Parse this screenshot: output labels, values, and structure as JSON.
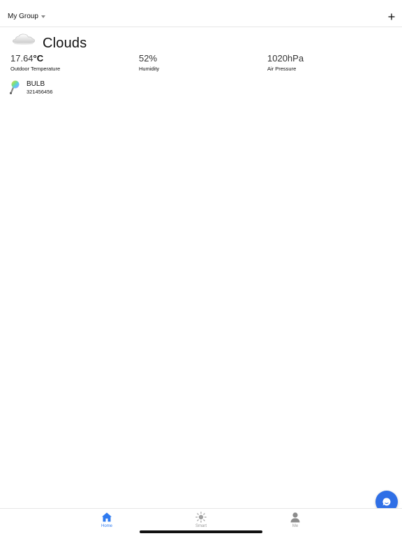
{
  "header": {
    "group_name": "My Group",
    "add_icon": "plus-icon"
  },
  "weather": {
    "icon": "cloud-icon",
    "condition": "Clouds",
    "temperature": {
      "value": "17.64",
      "unit": "°C",
      "label": "Outdoor Temperature"
    },
    "humidity": {
      "value": "52%",
      "label": "Humidity"
    },
    "pressure": {
      "value": "1020hPa",
      "label": "Air Pressure"
    }
  },
  "devices": [
    {
      "icon": "bulb-icon",
      "name": "BULB",
      "id": "321456456"
    }
  ],
  "fab": {
    "icon": "chat-icon",
    "color": "#2f6fe6"
  },
  "tabs": [
    {
      "label": "Home",
      "icon": "home-icon",
      "active": true
    },
    {
      "label": "Smart",
      "icon": "sun-icon",
      "active": false
    },
    {
      "label": "Me",
      "icon": "person-icon",
      "active": false
    }
  ],
  "colors": {
    "accent": "#2f7bf0",
    "inactive": "#999999"
  }
}
